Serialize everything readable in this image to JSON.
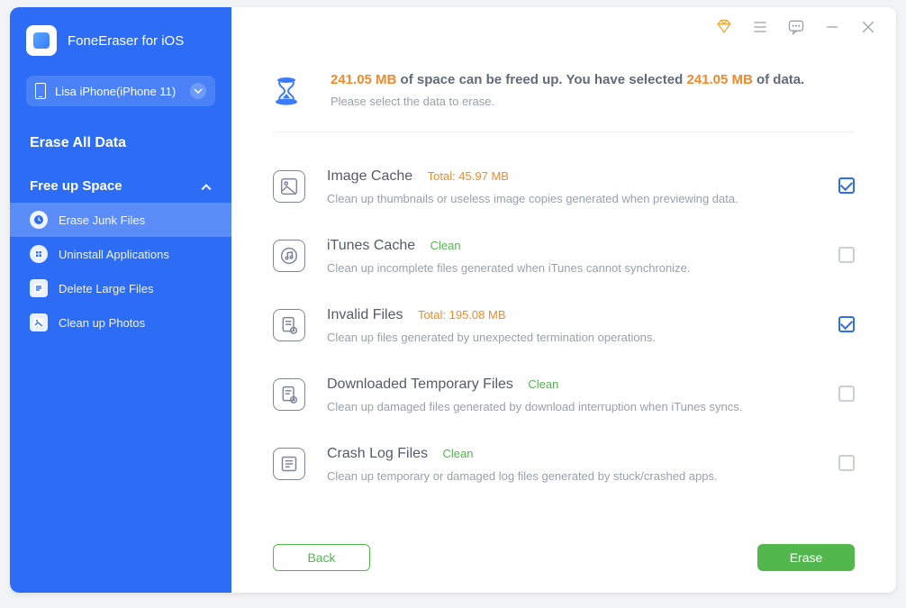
{
  "app": {
    "title": "FoneEraser for iOS"
  },
  "device": {
    "label": "Lisa iPhone(iPhone 11)"
  },
  "sidebar": {
    "erase_all": "Erase All Data",
    "free_up": "Free up Space",
    "items": [
      {
        "label": "Erase Junk Files"
      },
      {
        "label": "Uninstall Applications"
      },
      {
        "label": "Delete Large Files"
      },
      {
        "label": "Clean up Photos"
      }
    ]
  },
  "summary": {
    "free_value": "241.05 MB",
    "mid_text": " of space can be freed up. You have selected ",
    "selected_value": "241.05 MB",
    "tail_text": " of data.",
    "subtext": "Please select the data to erase."
  },
  "categories": [
    {
      "title": "Image Cache",
      "meta": "Total: 45.97 MB",
      "meta_class": "orange",
      "desc": "Clean up thumbnails or useless image copies generated when previewing data.",
      "checked": true
    },
    {
      "title": "iTunes Cache",
      "meta": "Clean",
      "meta_class": "green",
      "desc": "Clean up incomplete files generated when iTunes cannot synchronize.",
      "checked": false
    },
    {
      "title": "Invalid Files",
      "meta": "Total: 195.08 MB",
      "meta_class": "orange",
      "desc": "Clean up files generated by unexpected termination operations.",
      "checked": true
    },
    {
      "title": "Downloaded Temporary Files",
      "meta": "Clean",
      "meta_class": "green",
      "desc": "Clean up damaged files generated by download interruption when iTunes syncs.",
      "checked": false
    },
    {
      "title": "Crash Log Files",
      "meta": "Clean",
      "meta_class": "green",
      "desc": "Clean up temporary or damaged log files generated by stuck/crashed apps.",
      "checked": false
    }
  ],
  "buttons": {
    "back": "Back",
    "erase": "Erase"
  }
}
